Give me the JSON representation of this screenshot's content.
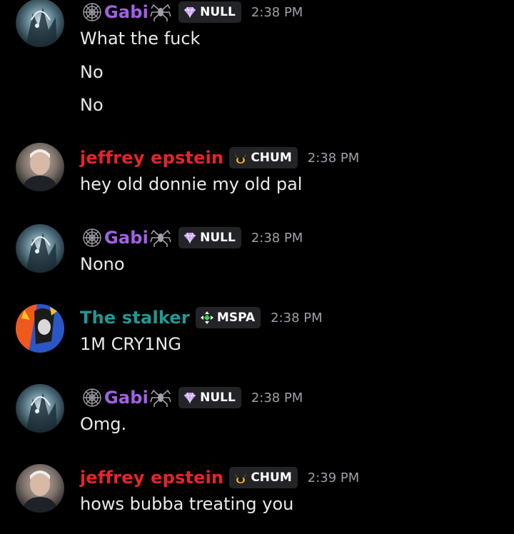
{
  "colors": {
    "gabi": "#a360e6",
    "jeffrey": "#e8242a",
    "stalker": "#1f9a96",
    "timestamp": "#9aa0a8",
    "message": "#e9e9ec"
  },
  "messages": [
    {
      "user": "Gabi",
      "avatar": "gabi-avatar",
      "badge_icon": "gem-icon",
      "badge": "NULL",
      "time": "2:38 PM",
      "lines": [
        "What the fuck",
        "No",
        "No"
      ]
    },
    {
      "user": "jeffrey epstein",
      "avatar": "jeffrey-avatar",
      "badge_icon": "horns-icon",
      "badge": "CHUM",
      "time": "2:38 PM",
      "lines": [
        "hey old donnie my old pal"
      ]
    },
    {
      "user": "Gabi",
      "avatar": "gabi-avatar",
      "badge_icon": "gem-icon",
      "badge": "NULL",
      "time": "2:38 PM",
      "lines": [
        "Nono"
      ]
    },
    {
      "user": "The stalker",
      "avatar": "stalker-avatar",
      "badge_icon": "diamond-arrows-icon",
      "badge": "MSPA",
      "time": "2:38 PM",
      "lines": [
        "1M CRY1NG"
      ]
    },
    {
      "user": "Gabi",
      "avatar": "gabi-avatar",
      "badge_icon": "gem-icon",
      "badge": "NULL",
      "time": "2:38 PM",
      "lines": [
        "Omg."
      ]
    },
    {
      "user": "jeffrey epstein",
      "avatar": "jeffrey-avatar",
      "badge_icon": "horns-icon",
      "badge": "CHUM",
      "time": "2:39 PM",
      "lines": [
        "hows bubba treating you"
      ]
    }
  ]
}
